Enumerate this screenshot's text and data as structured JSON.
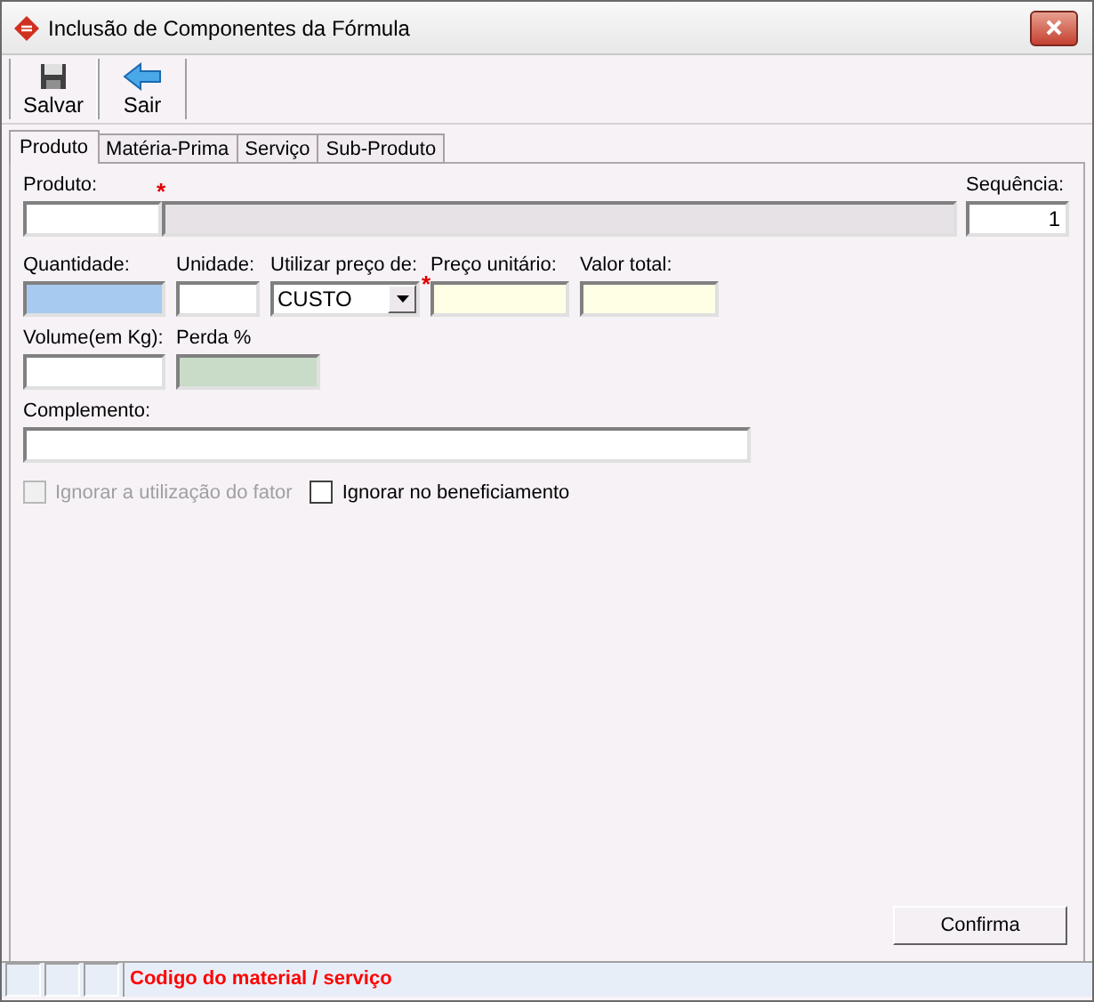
{
  "window": {
    "title": "Inclusão de Componentes da Fórmula"
  },
  "toolbar": [
    {
      "label": "Salvar",
      "kind": "save"
    },
    {
      "label": "Sair",
      "kind": "exit"
    }
  ],
  "tabs": [
    {
      "label": "Produto",
      "selected": true
    },
    {
      "label": "Matéria-Prima",
      "selected": false
    },
    {
      "label": "Serviço",
      "selected": false
    },
    {
      "label": "Sub-Produto",
      "selected": false
    }
  ],
  "produto": {
    "label": "Produto:",
    "marker": "*"
  },
  "sequencia": {
    "label": "Sequência:",
    "value": "1"
  },
  "row_fields": [
    {
      "label": "Quantidade:",
      "kind": "text",
      "color": "#a6caf0"
    },
    {
      "label": "Unidade:",
      "kind": "text",
      "color": "#ffffff"
    },
    {
      "label": "Utilizar preço de:",
      "kind": "select",
      "value": "CUSTO",
      "marker": "*"
    },
    {
      "label": "Preço unitário:",
      "kind": "text",
      "color": "#ffffe6"
    },
    {
      "label": "Valor total:",
      "kind": "text",
      "color": "#ffffe6"
    }
  ],
  "row2_fields": [
    {
      "label": "Volume(em Kg):",
      "kind": "text",
      "color": "#ffffff"
    },
    {
      "label": "Perda %",
      "kind": "text",
      "color": "#c8dcc8"
    }
  ],
  "complemento": {
    "label": "Complemento:"
  },
  "checkboxes": [
    {
      "label": "Ignorar a utilização do fator",
      "checked": false,
      "disabled": true
    },
    {
      "label": "Ignorar no beneficiamento",
      "checked": false,
      "disabled": false
    }
  ],
  "confirm_button": {
    "label": "Confirma"
  },
  "status_bar": {
    "message": "Codigo do material / serviço"
  }
}
